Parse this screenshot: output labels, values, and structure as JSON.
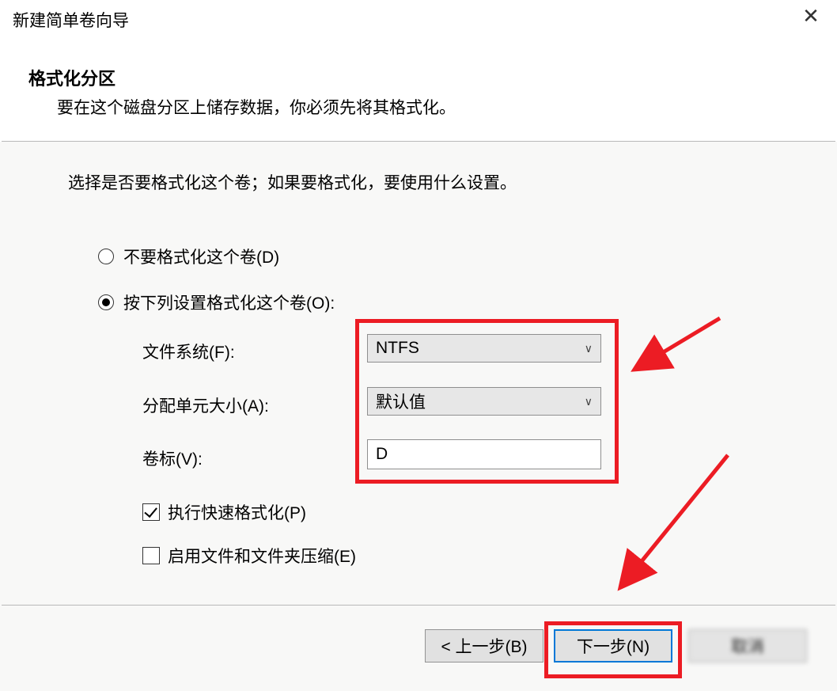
{
  "window": {
    "title": "新建简单卷向导"
  },
  "header": {
    "title": "格式化分区",
    "subtitle": "要在这个磁盘分区上储存数据，你必须先将其格式化。"
  },
  "body": {
    "instruction": "选择是否要格式化这个卷；如果要格式化，要使用什么设置。",
    "radio_no_format": "不要格式化这个卷(D)",
    "radio_format": "按下列设置格式化这个卷(O):",
    "label_filesystem": "文件系统(F):",
    "label_alloc": "分配单元大小(A):",
    "label_vollabel": "卷标(V):",
    "value_filesystem": "NTFS",
    "value_alloc": "默认值",
    "value_vollabel": "D",
    "chk_quick": "执行快速格式化(P)",
    "chk_compress": "启用文件和文件夹压缩(E)"
  },
  "footer": {
    "back": "< 上一步(B)",
    "next": "下一步(N)",
    "cancel": "取消"
  },
  "annotation_color": "#ec1c24"
}
